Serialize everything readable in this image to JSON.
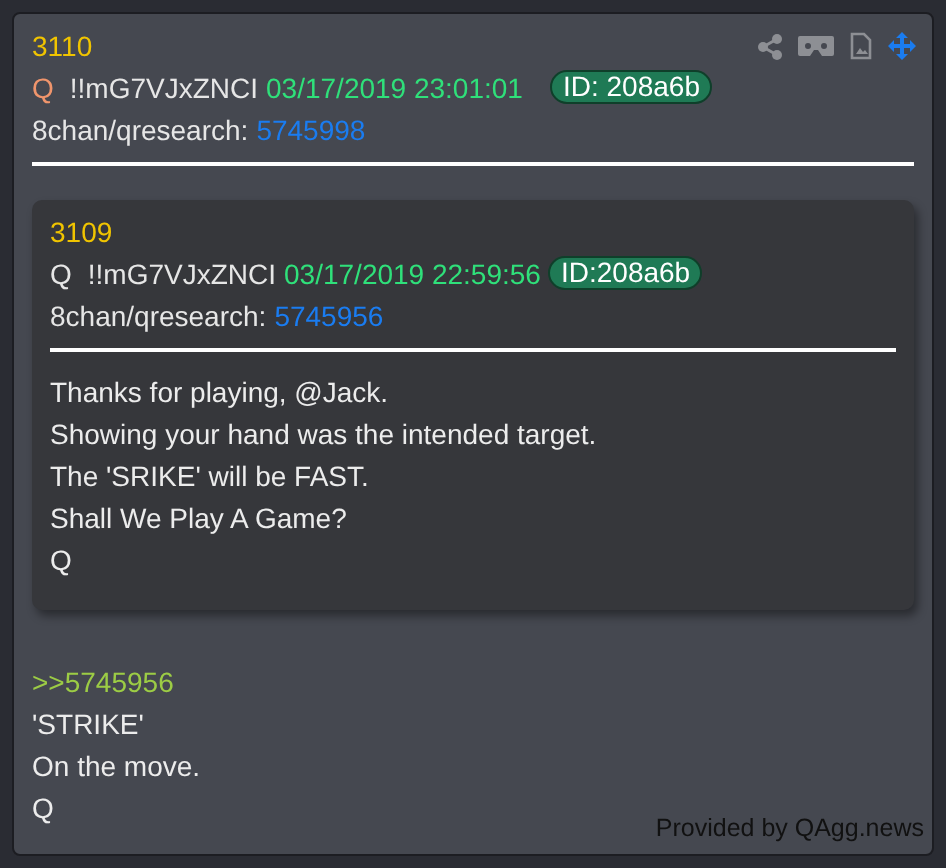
{
  "post": {
    "number": "3110",
    "author": "Q",
    "tripcode": "!!mG7VJxZNCI",
    "timestamp": "03/17/2019 23:01:01",
    "id_badge": "ID: 208a6b",
    "board": "8chan/qresearch:",
    "post_link": "5745998",
    "quoted": {
      "number": "3109",
      "author": "Q",
      "tripcode": "!!mG7VJxZNCI",
      "timestamp": "03/17/2019 22:59:56",
      "id_badge": "ID:208a6b",
      "board": "8chan/qresearch:",
      "post_link": "5745956",
      "lines": [
        "Thanks for playing, @Jack.",
        "Showing your hand was the intended target.",
        "The 'SRIKE' will be FAST.",
        "Shall We Play A Game?",
        "Q"
      ]
    },
    "reply_link": ">>5745956",
    "lines": [
      "'STRIKE'",
      "On the move.",
      "Q"
    ]
  },
  "footer": "Provided by QAgg.news"
}
